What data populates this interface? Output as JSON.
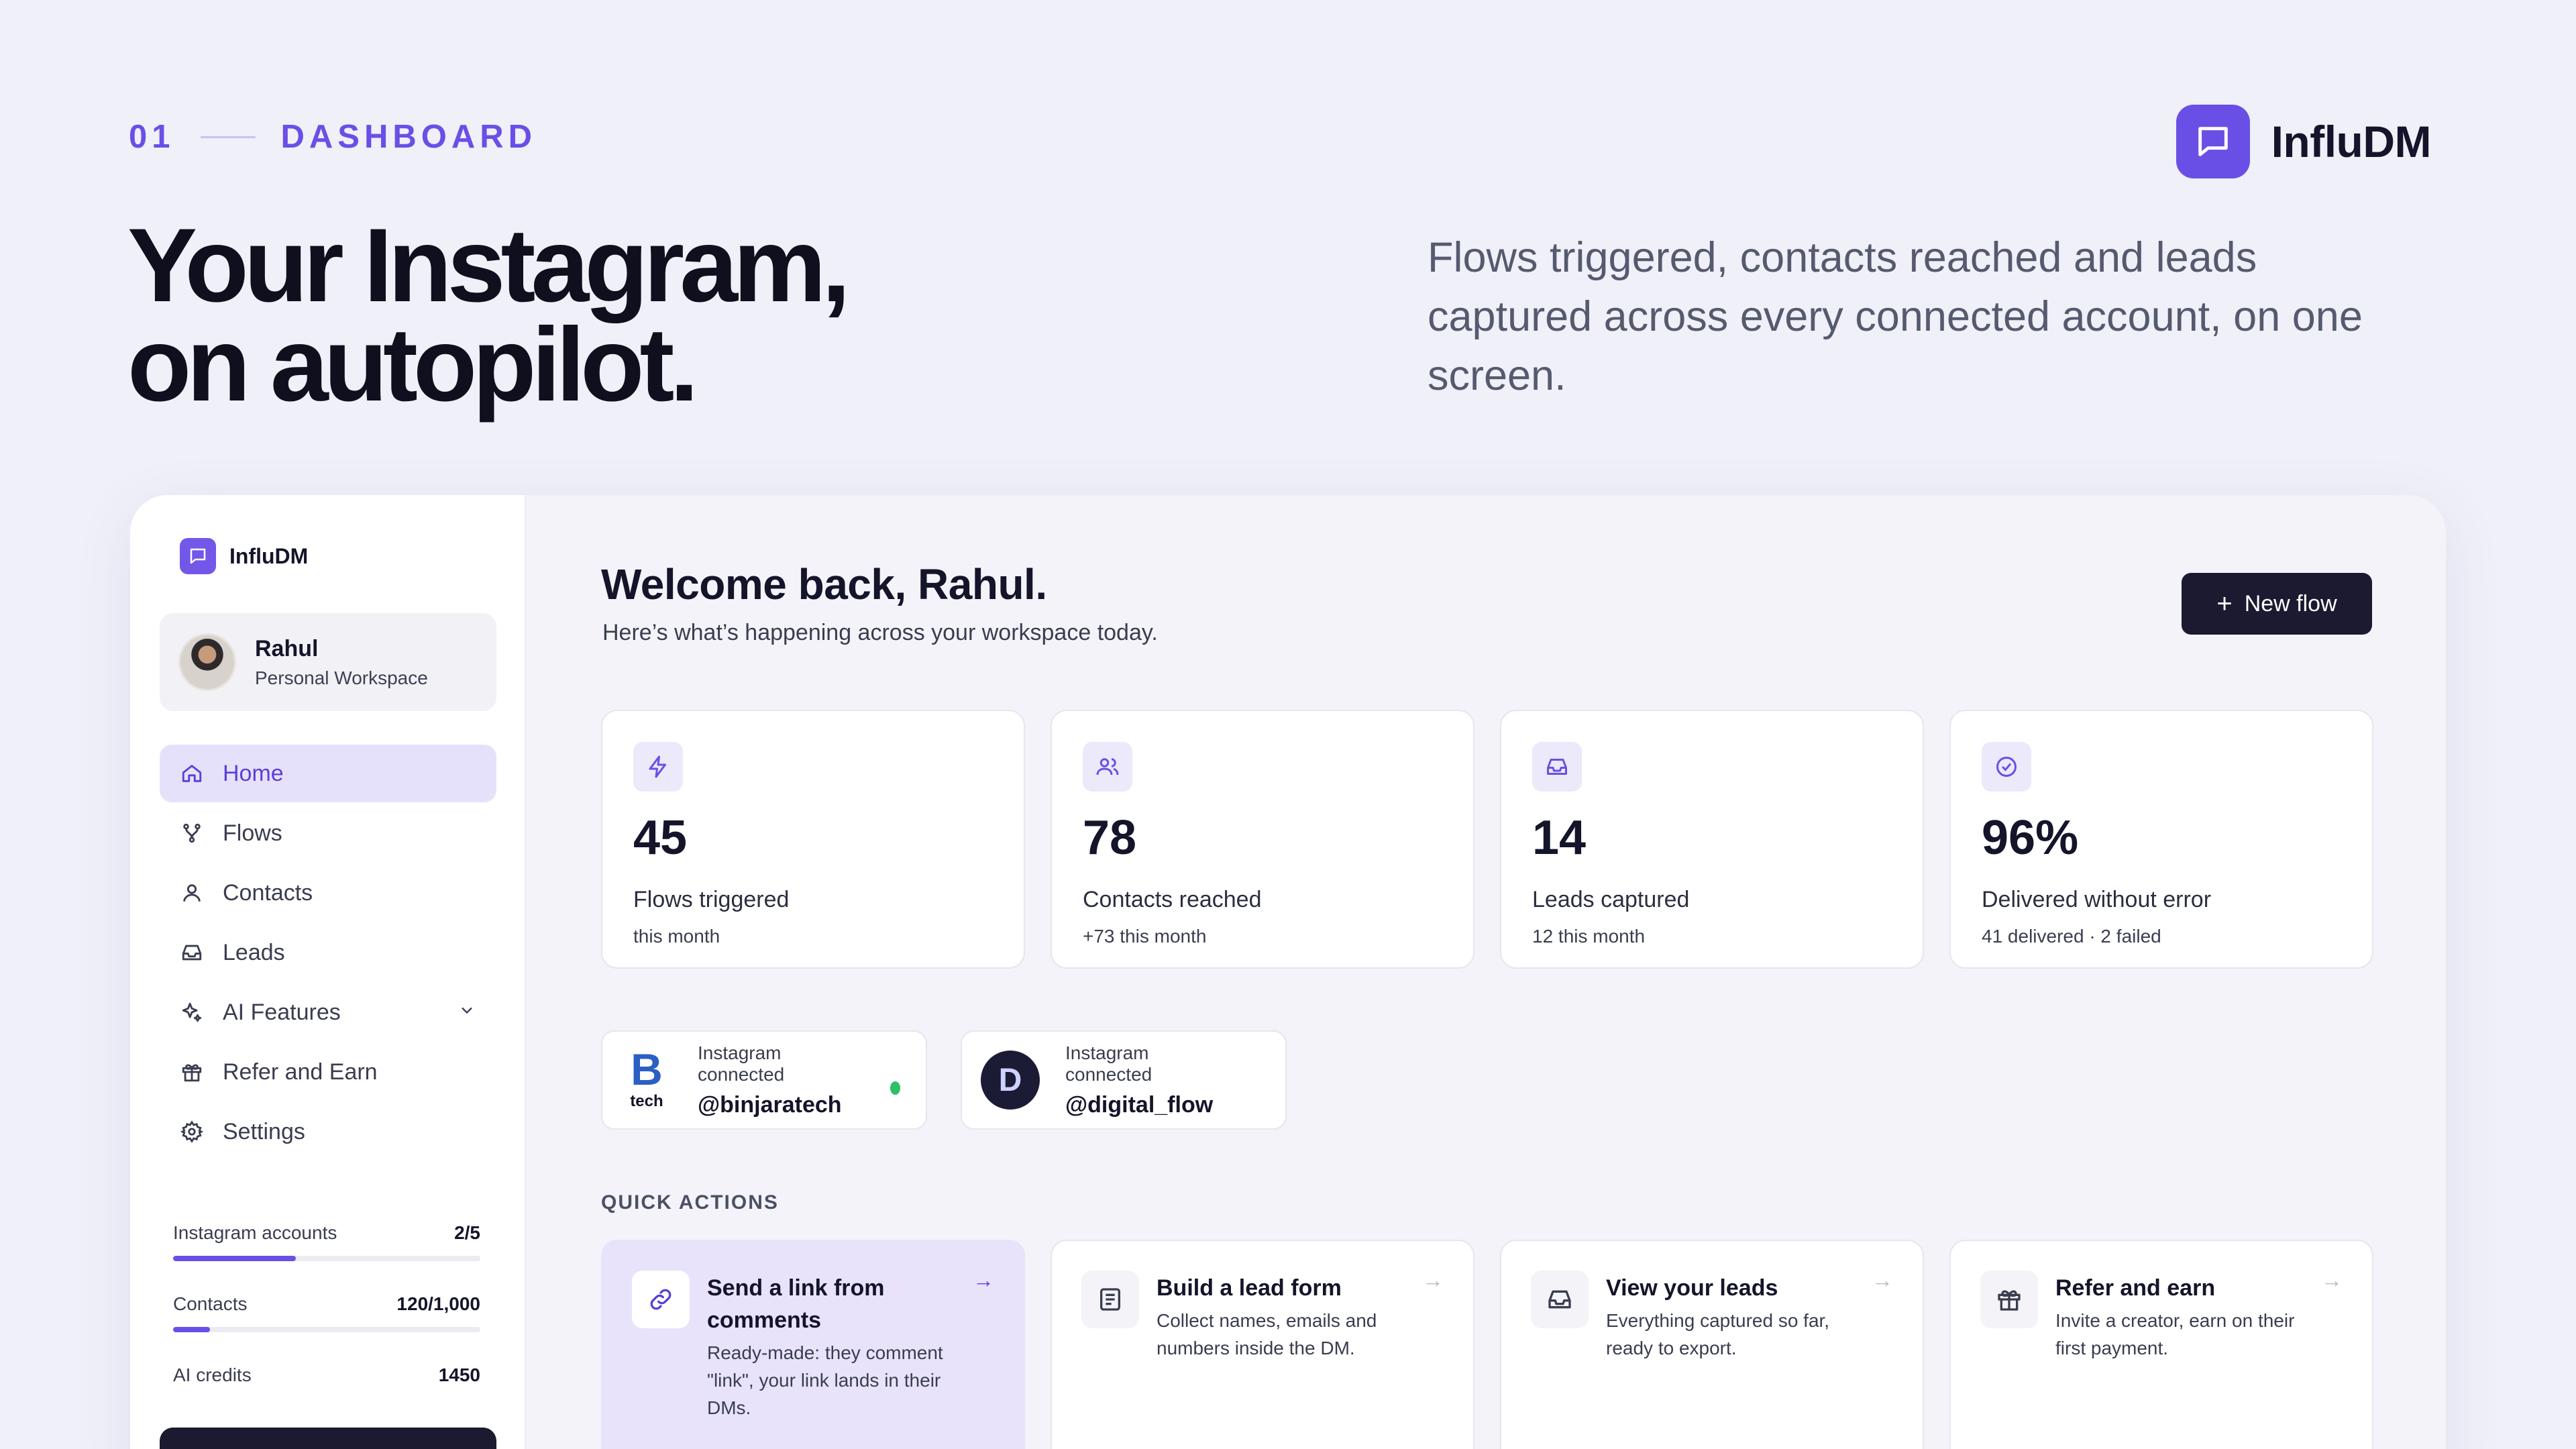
{
  "hero": {
    "eyebrow_num": "01",
    "eyebrow_label": "DASHBOARD",
    "brand_name": "InfluDM",
    "title_line1": "Your Instagram,",
    "title_line2": "on autopilot.",
    "subtitle": "Flows triggered, contacts reached and leads captured across every connected account, on one screen."
  },
  "sidebar": {
    "brand": "InfluDM",
    "user": {
      "name": "Rahul",
      "workspace": "Personal Workspace"
    },
    "nav": [
      {
        "label": "Home",
        "icon": "home-icon",
        "active": true
      },
      {
        "label": "Flows",
        "icon": "flows-icon"
      },
      {
        "label": "Contacts",
        "icon": "user-icon"
      },
      {
        "label": "Leads",
        "icon": "inbox-icon"
      },
      {
        "label": "AI Features",
        "icon": "sparkle-icon"
      },
      {
        "label": "Refer and Earn",
        "icon": "gift-icon"
      },
      {
        "label": "Settings",
        "icon": "gear-icon"
      }
    ],
    "usage": [
      {
        "label": "Instagram accounts",
        "value": "2/5",
        "progress": 0.4
      },
      {
        "label": "Contacts",
        "value": "120/1,000",
        "progress": 0.12
      },
      {
        "label": "AI credits",
        "value": "1450"
      }
    ]
  },
  "main": {
    "welcome": "Welcome back, Rahul.",
    "welcome_sub": "Here’s what’s happening across your workspace today.",
    "new_flow_label": "New flow",
    "stats": [
      {
        "value": "45",
        "label": "Flows triggered",
        "sub": "this month",
        "icon": "bolt-icon"
      },
      {
        "value": "78",
        "label": "Contacts reached",
        "sub": "+73 this month",
        "icon": "users-icon"
      },
      {
        "value": "14",
        "label": "Leads captured",
        "sub": "12 this month",
        "icon": "inbox-icon"
      },
      {
        "value": "96%",
        "label": "Delivered without error",
        "sub": "41 delivered · 2 failed",
        "icon": "check-circle-icon"
      }
    ],
    "accounts": [
      {
        "status": "Instagram connected",
        "handle": "@binjaratech",
        "logo_text": "tech",
        "logo_letter": "B"
      },
      {
        "status": "Instagram connected",
        "handle": "@digital_flow",
        "logo_letter": "D"
      }
    ],
    "quick_actions_title": "QUICK ACTIONS",
    "quick_actions": [
      {
        "title": "Send a link from comments",
        "desc": "Ready-made: they comment \"link\", your link lands in their DMs.",
        "icon": "link-icon"
      },
      {
        "title": "Build a lead form",
        "desc": "Collect names, emails and numbers inside the DM.",
        "icon": "form-icon"
      },
      {
        "title": "View your leads",
        "desc": "Everything captured so far, ready to export.",
        "icon": "inbox-icon"
      },
      {
        "title": "Refer and earn",
        "desc": "Invite a creator, earn on their first payment.",
        "icon": "gift-icon"
      }
    ]
  },
  "colors": {
    "accent": "#6a4fe6",
    "background": "#eff0f8",
    "dark_button": "#1b1a30",
    "status_connected": "#2ebf68"
  }
}
